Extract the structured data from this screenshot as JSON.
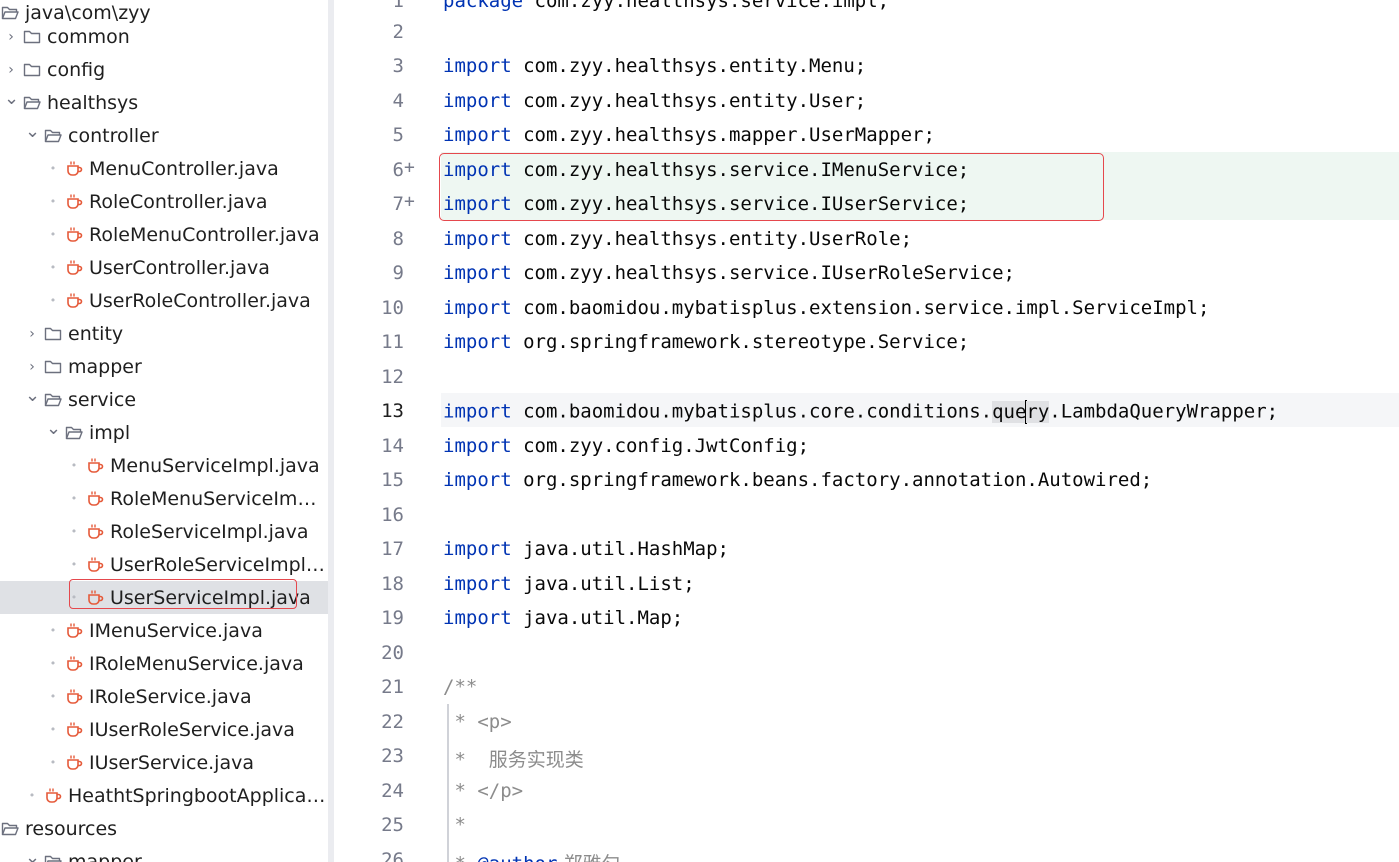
{
  "tree": {
    "rows": [
      {
        "label": "java\\com\\zyy",
        "kind": "folder",
        "open": true,
        "indent": 0,
        "chev": "none"
      },
      {
        "label": "common",
        "kind": "folder",
        "open": false,
        "indent": 0,
        "chev": "right"
      },
      {
        "label": "config",
        "kind": "folder",
        "open": false,
        "indent": 0,
        "chev": "right"
      },
      {
        "label": "healthsys",
        "kind": "folder",
        "open": true,
        "indent": 0,
        "chev": "down"
      },
      {
        "label": "controller",
        "kind": "folder",
        "open": true,
        "indent": 1,
        "chev": "down"
      },
      {
        "label": "MenuController.java",
        "kind": "java",
        "indent": 2,
        "chev": "dot"
      },
      {
        "label": "RoleController.java",
        "kind": "java",
        "indent": 2,
        "chev": "dot"
      },
      {
        "label": "RoleMenuController.java",
        "kind": "java",
        "indent": 2,
        "chev": "dot"
      },
      {
        "label": "UserController.java",
        "kind": "java",
        "indent": 2,
        "chev": "dot"
      },
      {
        "label": "UserRoleController.java",
        "kind": "java",
        "indent": 2,
        "chev": "dot"
      },
      {
        "label": "entity",
        "kind": "folder",
        "open": false,
        "indent": 1,
        "chev": "right"
      },
      {
        "label": "mapper",
        "kind": "folder",
        "open": false,
        "indent": 1,
        "chev": "right"
      },
      {
        "label": "service",
        "kind": "folder",
        "open": true,
        "indent": 1,
        "chev": "down"
      },
      {
        "label": "impl",
        "kind": "folder",
        "open": true,
        "indent": 2,
        "chev": "down"
      },
      {
        "label": "MenuServiceImpl.java",
        "kind": "java",
        "indent": 3,
        "chev": "dot"
      },
      {
        "label": "RoleMenuServiceImpl.j...",
        "kind": "java",
        "indent": 3,
        "chev": "dot"
      },
      {
        "label": "RoleServiceImpl.java",
        "kind": "java",
        "indent": 3,
        "chev": "dot"
      },
      {
        "label": "UserRoleServiceImpl.java",
        "kind": "java",
        "indent": 3,
        "chev": "dot"
      },
      {
        "label": "UserServiceImpl.java",
        "kind": "java",
        "indent": 3,
        "chev": "dot",
        "selected": true
      },
      {
        "label": "IMenuService.java",
        "kind": "java",
        "indent": 2,
        "chev": "dot"
      },
      {
        "label": "IRoleMenuService.java",
        "kind": "java",
        "indent": 2,
        "chev": "dot"
      },
      {
        "label": "IRoleService.java",
        "kind": "java",
        "indent": 2,
        "chev": "dot"
      },
      {
        "label": "IUserRoleService.java",
        "kind": "java",
        "indent": 2,
        "chev": "dot"
      },
      {
        "label": "IUserService.java",
        "kind": "java",
        "indent": 2,
        "chev": "dot"
      },
      {
        "label": "HeathtSpringbootApplication.j...",
        "kind": "java",
        "indent": 1,
        "chev": "dot"
      },
      {
        "label": "resources",
        "kind": "folder",
        "open": true,
        "indent": 0,
        "chev": "none"
      },
      {
        "label": "mapper",
        "kind": "folder",
        "open": true,
        "indent": 1,
        "chev": "down"
      }
    ]
  },
  "editor": {
    "lines": [
      {
        "n": "1",
        "kw": "package",
        "rest": " com.zyy.healthsys.service.impl;"
      },
      {
        "n": "2",
        "kw": "",
        "rest": ""
      },
      {
        "n": "3",
        "kw": "import",
        "rest": " com.zyy.healthsys.entity.Menu;"
      },
      {
        "n": "4",
        "kw": "import",
        "rest": " com.zyy.healthsys.entity.User;"
      },
      {
        "n": "5",
        "kw": "import",
        "rest": " com.zyy.healthsys.mapper.UserMapper;"
      },
      {
        "n": "6",
        "kw": "import",
        "rest": " com.zyy.healthsys.service.IMenuService;",
        "changed": true,
        "plus": "+"
      },
      {
        "n": "7",
        "kw": "import",
        "rest": " com.zyy.healthsys.service.IUserService;",
        "changed": true,
        "plus": "+"
      },
      {
        "n": "8",
        "kw": "import",
        "rest": " com.zyy.healthsys.entity.UserRole;"
      },
      {
        "n": "9",
        "kw": "import",
        "rest": " com.zyy.healthsys.service.IUserRoleService;"
      },
      {
        "n": "10",
        "kw": "import",
        "rest": " com.baomidou.mybatisplus.extension.service.impl.ServiceImpl;"
      },
      {
        "n": "11",
        "kw": "import",
        "rest": " org.springframework.stereotype.Service;"
      },
      {
        "n": "12",
        "kw": "",
        "rest": ""
      },
      {
        "n": "13",
        "kw": "import",
        "pre": " com.baomidou.mybatisplus.core.conditions.",
        "hlA": "que",
        "hlB": "ry",
        "post": ".LambdaQueryWrapper;",
        "current": true
      },
      {
        "n": "14",
        "kw": "import",
        "rest": " com.zyy.config.JwtConfig;"
      },
      {
        "n": "15",
        "kw": "import",
        "rest": " org.springframework.beans.factory.annotation.Autowired;"
      },
      {
        "n": "16",
        "kw": "",
        "rest": ""
      },
      {
        "n": "17",
        "kw": "import",
        "rest": " java.util.HashMap;"
      },
      {
        "n": "18",
        "kw": "import",
        "rest": " java.util.List;"
      },
      {
        "n": "19",
        "kw": "import",
        "rest": " java.util.Map;"
      },
      {
        "n": "20",
        "kw": "",
        "rest": ""
      },
      {
        "n": "21",
        "cmt": "/**"
      },
      {
        "n": "22",
        "cmt": " * <p>"
      },
      {
        "n": "23",
        "cmt": " *  ",
        "cjk": "服务实现类"
      },
      {
        "n": "24",
        "cmt": " * </p>"
      },
      {
        "n": "25",
        "cmt": " *"
      },
      {
        "n": "26",
        "cmt": " * ",
        "ann": "@author",
        "cjk": " 郑雅匀"
      }
    ]
  },
  "colors": {
    "keyword": "#0033b3",
    "highlight_box": "#e5484d",
    "java_icon": "#e55a3a",
    "changed_line": "#eef7f2"
  }
}
